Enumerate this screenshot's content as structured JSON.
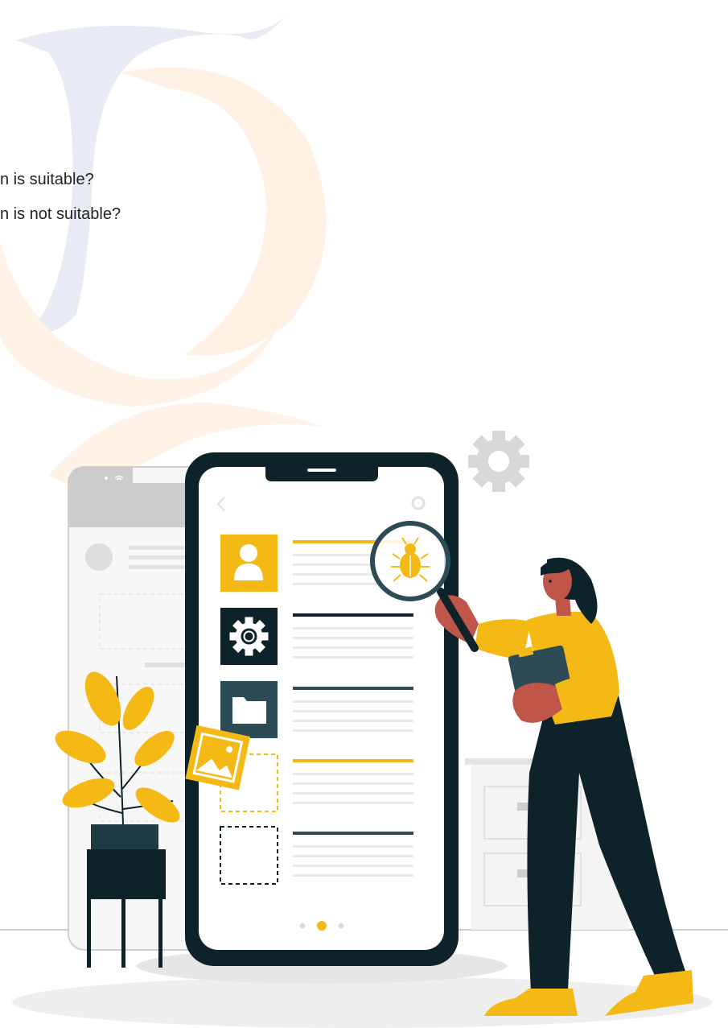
{
  "questions": [
    "n is suitable?",
    "n is not suitable?"
  ],
  "colors": {
    "accent": "#F5B915",
    "dark": "#0E2329",
    "teal": "#2D4B55",
    "skin": "#C0564A",
    "watermark_blue": "#E8EAF3",
    "watermark_peach": "#FFF3E8"
  },
  "illustration": {
    "icons": [
      "gear-icon",
      "user-icon",
      "folder-icon",
      "image-icon",
      "bug-icon",
      "magnifier-icon",
      "back-chevron-icon",
      "wifi-icon"
    ]
  }
}
